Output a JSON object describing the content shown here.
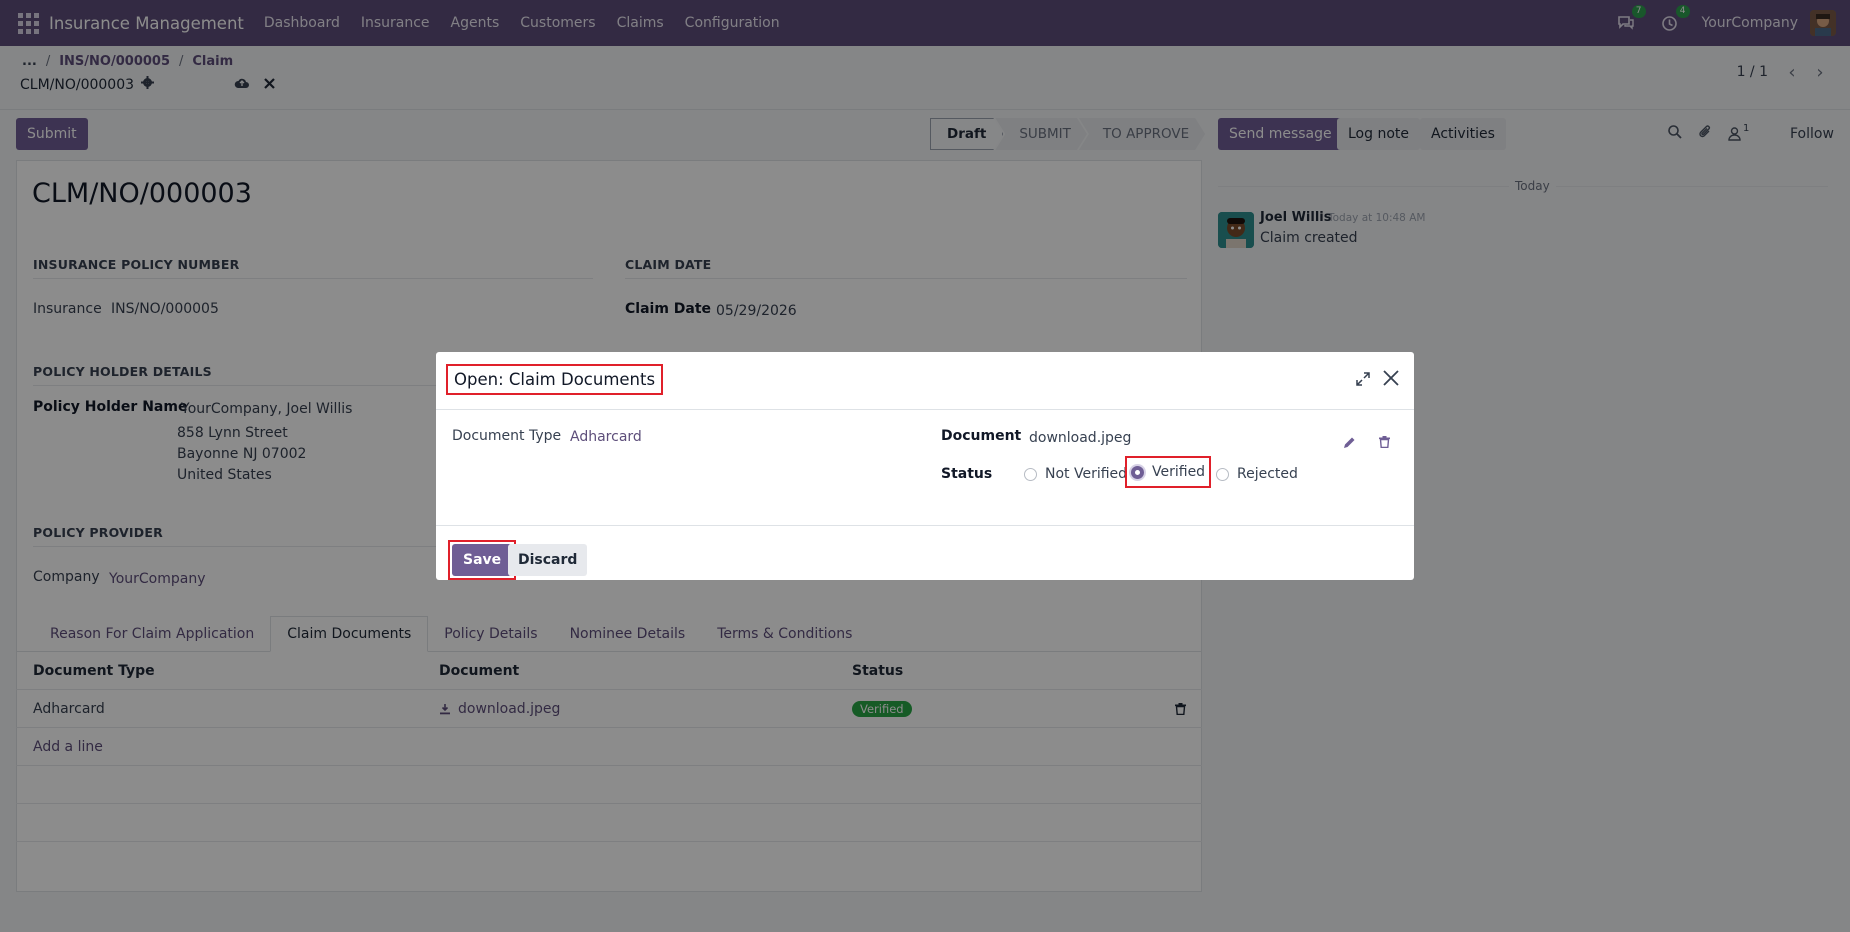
{
  "navbar": {
    "brand": "Insurance Management",
    "menu": [
      "Dashboard",
      "Insurance",
      "Agents",
      "Customers",
      "Claims",
      "Configuration"
    ],
    "messages_badge": "7",
    "activities_badge": "4",
    "company": "YourCompany"
  },
  "breadcrumb": {
    "ellipsis": "...",
    "items": [
      "INS/NO/000005",
      "Claim"
    ],
    "sep": "/"
  },
  "record": {
    "name": "CLM/NO/000003"
  },
  "pager": {
    "text": "1 / 1"
  },
  "form": {
    "submit_label": "Submit",
    "stages": [
      "Draft",
      "SUBMIT",
      "TO APPROVE"
    ],
    "title": "CLM/NO/000003",
    "section_policy": "INSURANCE POLICY NUMBER",
    "insurance_label": "Insurance",
    "insurance_value": "INS/NO/000005",
    "section_claim_date": "CLAIM DATE",
    "claim_date_label": "Claim Date",
    "claim_date_value": "05/29/2026",
    "section_holder": "POLICY HOLDER DETAILS",
    "holder_label": "Policy Holder Name",
    "holder_name": "YourCompany, Joel Willis",
    "holder_addr1": "858 Lynn Street",
    "holder_addr2": "Bayonne NJ 07002",
    "holder_addr3": "United States",
    "section_provider": "POLICY PROVIDER",
    "company_label": "Company",
    "company_value": "YourCompany"
  },
  "tabs": [
    "Reason For Claim Application",
    "Claim Documents",
    "Policy Details",
    "Nominee Details",
    "Terms & Conditions"
  ],
  "table": {
    "headers": [
      "Document Type",
      "Document",
      "Status"
    ],
    "rows": [
      {
        "type": "Adharcard",
        "document": "download.jpeg",
        "status": "Verified"
      }
    ],
    "add_line": "Add a line"
  },
  "chatter": {
    "send_message": "Send message",
    "log_note": "Log note",
    "activities": "Activities",
    "followers_count": "1",
    "follow": "Follow",
    "today": "Today",
    "message": {
      "author": "Joel Willis",
      "time": "Today at 10:48 AM",
      "body": "Claim created"
    }
  },
  "modal": {
    "title": "Open: Claim Documents",
    "doc_type_label": "Document Type",
    "doc_type_value": "Adharcard",
    "document_label": "Document",
    "document_value": "download.jpeg",
    "status_label": "Status",
    "status_options": [
      "Not Verified",
      "Verified",
      "Rejected"
    ],
    "status_selected": "Verified",
    "save_label": "Save",
    "discard_label": "Discard"
  },
  "colors": {
    "navbar": "#5d4e7a",
    "primary": "#6f5e95",
    "highlight": "#e0202a",
    "success": "#28a745"
  }
}
